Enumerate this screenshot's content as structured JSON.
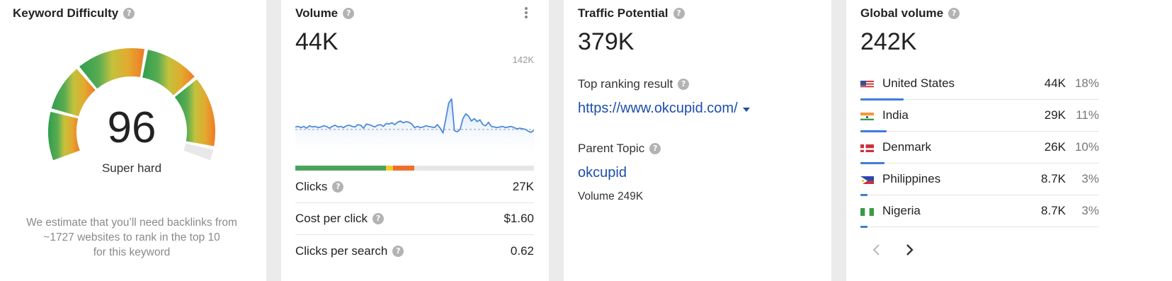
{
  "keyword_difficulty": {
    "title": "Keyword Difficulty",
    "score": "96",
    "label": "Super hard",
    "note_lines": [
      "We estimate that you’ll need backlinks from",
      "~1727 websites to rank in the top 10",
      "for this keyword"
    ],
    "gauge_colors": [
      "#2f9e4d",
      "#5aac52",
      "#c2c23c",
      "#e3aa2e",
      "#ef7a27"
    ]
  },
  "volume": {
    "title": "Volume",
    "value": "44K",
    "chart_max_label": "142K",
    "difficulty_bar": [
      {
        "color": "#4aa35a",
        "fraction": 0.38
      },
      {
        "color": "#f2cb30",
        "fraction": 0.03
      },
      {
        "color": "#ee6f2b",
        "fraction": 0.09
      }
    ],
    "metrics": [
      {
        "label": "Clicks",
        "value": "27K"
      },
      {
        "label": "Cost per click",
        "value": "$1.60"
      },
      {
        "label": "Clicks per search",
        "value": "0.62"
      }
    ]
  },
  "chart_data": {
    "type": "area",
    "ymax_label": "142K",
    "ylim": [
      0,
      142
    ],
    "values": [
      48,
      49,
      47,
      49,
      46,
      50,
      48,
      49,
      47,
      48,
      50,
      49,
      46,
      49,
      51,
      48,
      49,
      47,
      50,
      51,
      49,
      48,
      52,
      51,
      46,
      53,
      52,
      50,
      48,
      51,
      52,
      49,
      54,
      53,
      55,
      52,
      56,
      58,
      55,
      57,
      56,
      53,
      47,
      49,
      47,
      48,
      50,
      49,
      48,
      47,
      52,
      46,
      38,
      62,
      88,
      95,
      42,
      40,
      44,
      62,
      70,
      66,
      58,
      62,
      57,
      60,
      52,
      50,
      56,
      49,
      48,
      47,
      48,
      49,
      47,
      48,
      49,
      47,
      45,
      46,
      45,
      44,
      41,
      39,
      43
    ],
    "average": 44
  },
  "traffic_potential": {
    "title": "Traffic Potential",
    "value": "379K",
    "top_result_label": "Top ranking result",
    "top_result_url": "https://www.okcupid.com/",
    "parent_topic_label": "Parent Topic",
    "parent_topic": "okcupid",
    "parent_volume": "Volume 249K"
  },
  "global_volume": {
    "title": "Global volume",
    "value": "242K",
    "countries": [
      {
        "name": "United States",
        "volume": "44K",
        "pct": "18%",
        "share": 0.18,
        "flag": "us-flag"
      },
      {
        "name": "India",
        "volume": "29K",
        "pct": "11%",
        "share": 0.11,
        "flag": "india-flag"
      },
      {
        "name": "Denmark",
        "volume": "26K",
        "pct": "10%",
        "share": 0.1,
        "flag": "denmark-flag"
      },
      {
        "name": "Philippines",
        "volume": "8.7K",
        "pct": "3%",
        "share": 0.03,
        "flag": "philippines-flag"
      },
      {
        "name": "Nigeria",
        "volume": "8.7K",
        "pct": "3%",
        "share": 0.03,
        "flag": "nigeria-flag"
      }
    ],
    "prev_icon": "chevron-left-icon",
    "next_icon": "chevron-right-icon",
    "accent": "#3e7dd6"
  }
}
